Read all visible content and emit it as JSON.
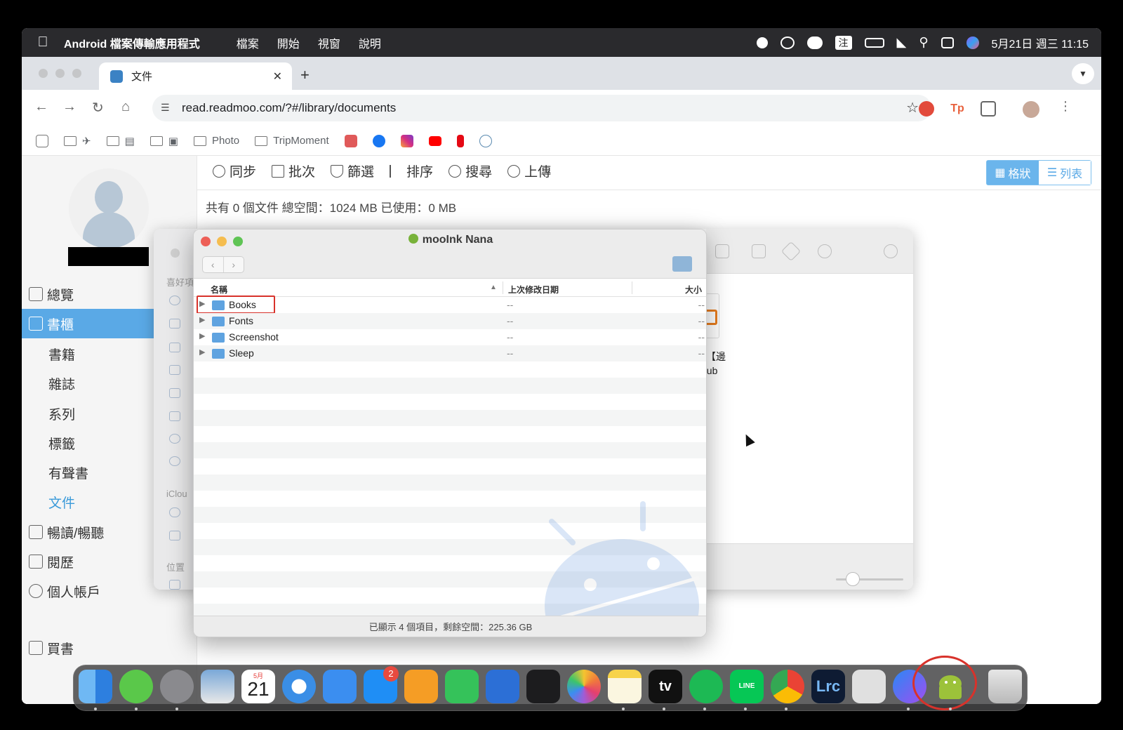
{
  "menubar": {
    "app_name": "Android 檔案傳輸應用程式",
    "items": [
      "檔案",
      "開始",
      "視窗",
      "說明"
    ],
    "ime": "注",
    "datetime": "5月21日 週三 11:15"
  },
  "browser": {
    "tab_title": "文件",
    "url": "read.readmoo.com/?#/library/documents",
    "bookmarks": [
      "Photo",
      "TripMoment"
    ]
  },
  "readmoo": {
    "nav": [
      {
        "label": "總覽",
        "type": "top"
      },
      {
        "label": "書櫃",
        "type": "top",
        "active": true
      },
      {
        "label": "書籍",
        "type": "sub"
      },
      {
        "label": "雜誌",
        "type": "sub"
      },
      {
        "label": "系列",
        "type": "sub"
      },
      {
        "label": "標籤",
        "type": "sub"
      },
      {
        "label": "有聲書",
        "type": "sub"
      },
      {
        "label": "文件",
        "type": "sub",
        "selected": true
      },
      {
        "label": "暢讀/暢聽",
        "type": "top"
      },
      {
        "label": "閱歷",
        "type": "top"
      },
      {
        "label": "個人帳戶",
        "type": "top"
      },
      {
        "label": "買書",
        "type": "top"
      }
    ],
    "actions": [
      "同步",
      "批次",
      "篩選",
      "排序",
      "搜尋",
      "上傳"
    ],
    "view_grid": "格狀",
    "view_list": "列表",
    "summary": "共有 0 個文件 總空間：1024 MB 已使用：0 MB"
  },
  "back_finder": {
    "sidebar_labels": [
      "喜好項",
      "iClou",
      "位置"
    ],
    "file_label_line1": "：【邊",
    "file_label_line2": "pub"
  },
  "finder": {
    "title": "mooInk Nana",
    "col_name": "名稱",
    "col_date": "上次修改日期",
    "col_size": "大小",
    "rows": [
      {
        "name": "Books",
        "date": "--",
        "size": "--"
      },
      {
        "name": "Fonts",
        "date": "--",
        "size": "--"
      },
      {
        "name": "Screenshot",
        "date": "--",
        "size": "--"
      },
      {
        "name": "Sleep",
        "date": "--",
        "size": "--"
      }
    ],
    "status": "已顯示 4 個項目，剩餘空間：225.36 GB"
  },
  "dock": {
    "calendar_month": "5月",
    "calendar_day": "21",
    "appstore_badge": "2",
    "tv_label": "tv",
    "lrc_label": "Lrc",
    "line_label": "LINE"
  }
}
